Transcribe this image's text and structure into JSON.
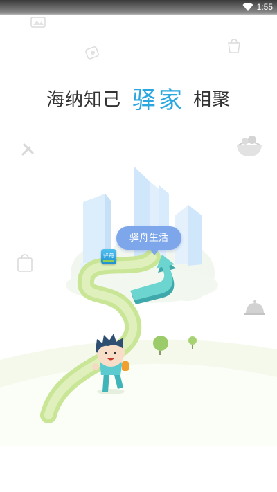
{
  "status_bar": {
    "time": "1:55"
  },
  "headline": {
    "part1": "海纳知己",
    "brand": "驿家",
    "part2": "相聚"
  },
  "scene": {
    "tag_label": "驿舟生活",
    "app_icon_label": "驿舟",
    "icons": [
      "wifi-icon",
      "photo-icon",
      "coin-icon",
      "cart-icon",
      "salad-bowl-icon",
      "wrench-icon",
      "shopping-bag-icon",
      "service-bell-icon",
      "city-buildings-illustration",
      "up-arrow-icon",
      "tree-icon",
      "boy-character-illustration"
    ]
  },
  "colors": {
    "brand": "#2aa7e0",
    "tag": "#7ea6ea",
    "path": "#c6e48f",
    "building": "#d3e9fb",
    "arrow": "#66cfcc"
  }
}
